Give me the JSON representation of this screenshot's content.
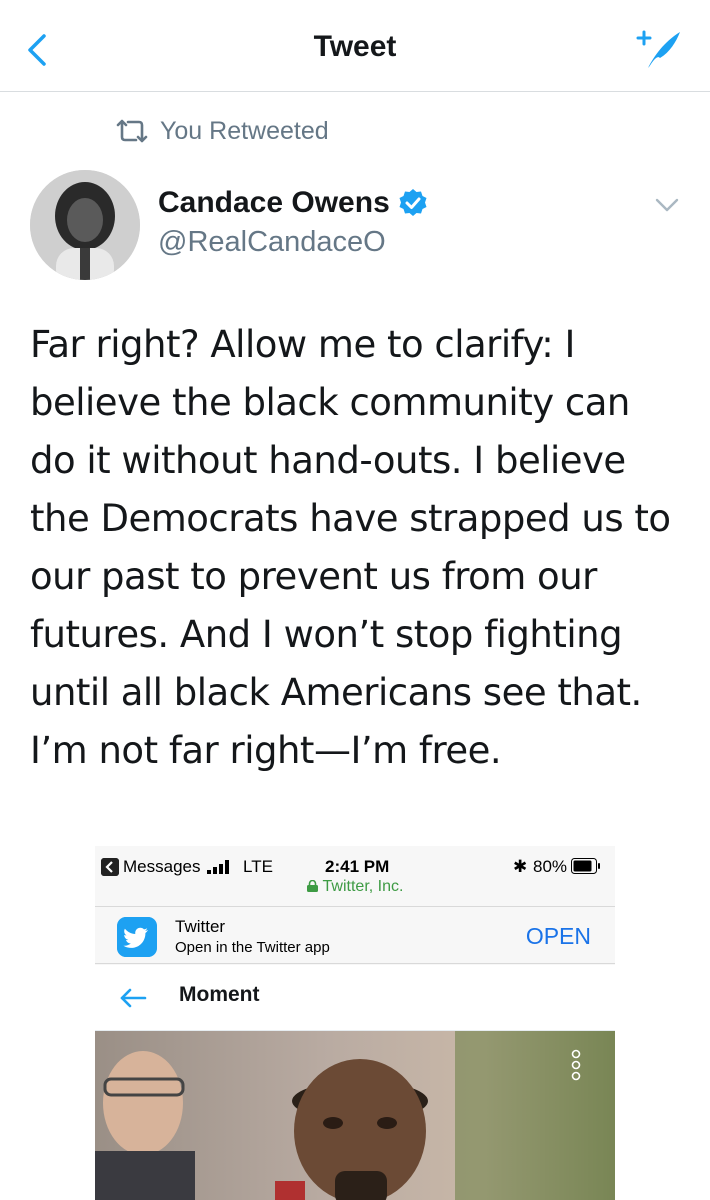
{
  "navbar": {
    "title": "Tweet",
    "back_icon": "chevron-left-icon",
    "compose_icon": "compose-tweet-icon"
  },
  "retweet_context": {
    "label": "You Retweeted",
    "icon": "retweet-icon"
  },
  "tweet": {
    "author_name": "Candace Owens",
    "author_handle": "@RealCandaceO",
    "verified": true,
    "text_lines": [
      "Far right? Allow me to clarify: I",
      "believe the black community can",
      "do it without hand-outs. I believe",
      "the Democrats have strapped us to",
      "our past to prevent us from our",
      "futures. And I won’t stop fighting",
      "until all black Americans see that.",
      "I’m not far right—I’m free."
    ]
  },
  "embed": {
    "status_bar": {
      "back_app": "Messages",
      "network": "LTE",
      "time": "2:41 PM",
      "battery": "80%",
      "url_label": "Twitter, Inc."
    },
    "app_banner": {
      "app_name": "Twitter",
      "subtitle": "Open in the Twitter app",
      "open_label": "OPEN"
    },
    "moment": {
      "title": "Moment"
    }
  },
  "colors": {
    "twitter_blue": "#1da1f2",
    "secondary_text": "#657786",
    "primary_text": "#14171a",
    "divider": "#d9dde0"
  }
}
